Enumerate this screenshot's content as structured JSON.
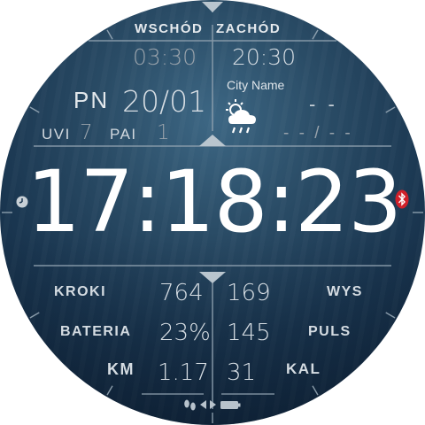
{
  "sun": {
    "sunrise_label": "WSCHÓD",
    "sunset_label": "ZACHÓD",
    "sunrise_time": "03:30",
    "sunset_time": "20:30"
  },
  "date": {
    "weekday": "PN",
    "day_month": "20/01"
  },
  "uv": {
    "uvi_label": "UVI",
    "uvi_value": "7",
    "pai_label": "PAI",
    "pai_value": "1"
  },
  "weather": {
    "city": "City Name",
    "icon": "partly-cloudy-rain-icon",
    "temperature": "- -",
    "min_max": "- - / - -"
  },
  "time": {
    "display": "17:18:23"
  },
  "stats": {
    "steps_label": "KROKI",
    "steps_value": "764",
    "battery_label": "BATERIA",
    "battery_value": "23%",
    "distance_label": "KM",
    "distance_value": "1.17",
    "altitude_label": "WYS",
    "altitude_value": "169",
    "pulse_label": "PULS",
    "pulse_value": "145",
    "calories_label": "KAL",
    "calories_value": "31"
  },
  "icons": {
    "alarm": "alarm-clock-icon",
    "bluetooth": "bluetooth-icon",
    "bluetooth_color": "#d0202a",
    "bottom": [
      "footprints-icon",
      "triangle-left-icon",
      "triangle-right-icon",
      "battery-icon"
    ]
  }
}
